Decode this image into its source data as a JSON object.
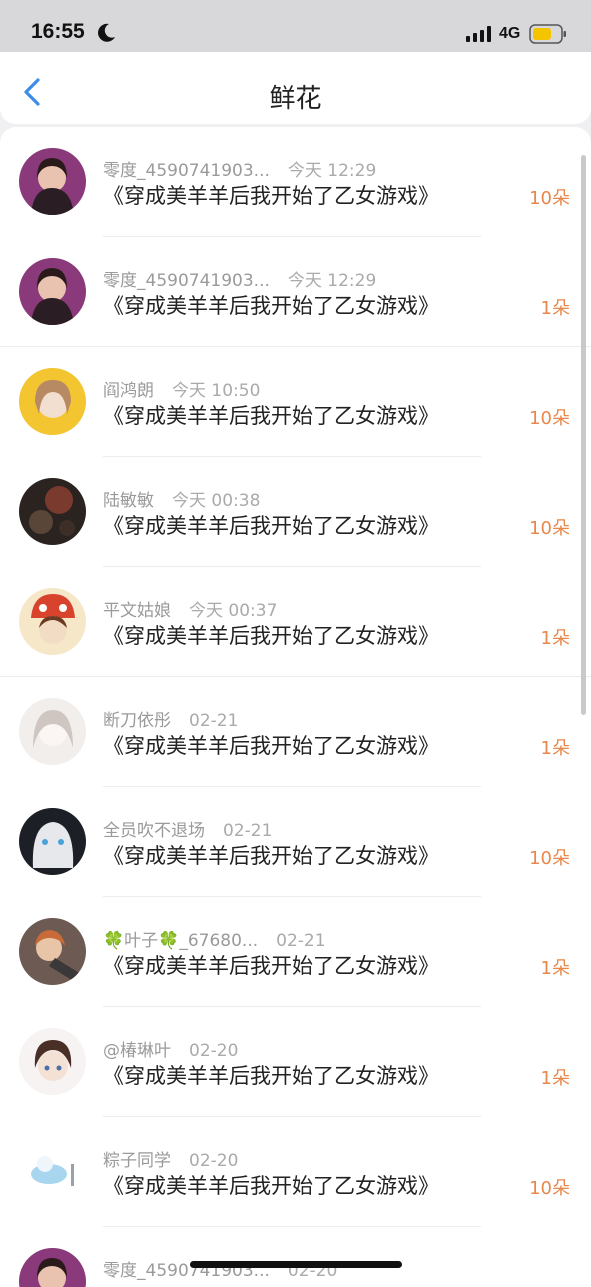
{
  "status_bar": {
    "time": "16:55",
    "network": "4G",
    "icons": [
      "moon-icon",
      "signal-icon",
      "battery-icon"
    ]
  },
  "nav": {
    "title": "鲜花",
    "back_icon": "chevron-left-icon",
    "accent_color": "#3a8ee6"
  },
  "colors": {
    "amount": "#e8874a",
    "meta": "#9a9a9a"
  },
  "rows": [
    {
      "user": "零度_4590741903...",
      "time": "今天 12:29",
      "book": "《穿成美羊羊后我开始了乙女游戏》",
      "amount": "10朵"
    },
    {
      "user": "零度_4590741903...",
      "time": "今天 12:29",
      "book": "《穿成美羊羊后我开始了乙女游戏》",
      "amount": "1朵"
    },
    {
      "user": "阎鸿朗",
      "time": "今天 10:50",
      "book": "《穿成美羊羊后我开始了乙女游戏》",
      "amount": "10朵"
    },
    {
      "user": "陆敏敏",
      "time": "今天 00:38",
      "book": "《穿成美羊羊后我开始了乙女游戏》",
      "amount": "10朵"
    },
    {
      "user": "平文姑娘",
      "time": "今天 00:37",
      "book": "《穿成美羊羊后我开始了乙女游戏》",
      "amount": "1朵"
    },
    {
      "user": "断刀依彤",
      "time": "02-21",
      "book": "《穿成美羊羊后我开始了乙女游戏》",
      "amount": "1朵"
    },
    {
      "user": "全员吹不退场",
      "time": "02-21",
      "book": "《穿成美羊羊后我开始了乙女游戏》",
      "amount": "10朵"
    },
    {
      "user": "🍀叶子🍀_67680...",
      "time": "02-21",
      "book": "《穿成美羊羊后我开始了乙女游戏》",
      "amount": "1朵"
    },
    {
      "user": "@椿琳叶",
      "time": "02-20",
      "book": "《穿成美羊羊后我开始了乙女游戏》",
      "amount": "1朵"
    },
    {
      "user": "粽子同学",
      "time": "02-20",
      "book": "《穿成美羊羊后我开始了乙女游戏》",
      "amount": "10朵"
    },
    {
      "user": "零度_4590741903...",
      "time": "02-20",
      "book": "",
      "amount": ""
    }
  ]
}
